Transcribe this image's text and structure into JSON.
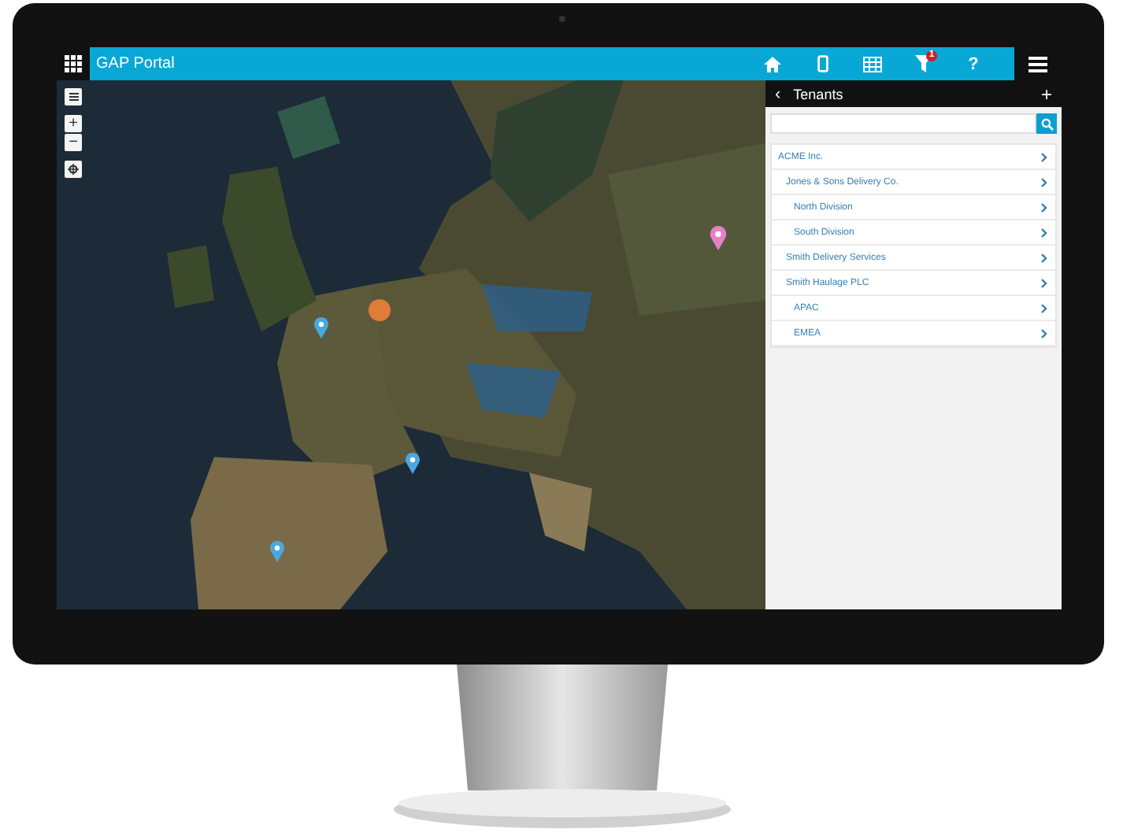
{
  "app_bar": {
    "title": "GAP Portal",
    "filter_badge": "1",
    "help": "?"
  },
  "map": {
    "zoom_in": "+",
    "zoom_out": "−"
  },
  "panel": {
    "title": "Tenants",
    "back": "‹",
    "add": "+",
    "tree": [
      {
        "label": "ACME Inc.",
        "children": [
          {
            "label": "Jones & Sons Delivery Co.",
            "children": [
              {
                "label": "North Division"
              },
              {
                "label": "South Division"
              }
            ]
          },
          {
            "label": "Smith Delivery Services"
          },
          {
            "label": "Smith Haulage PLC",
            "children": [
              {
                "label": "APAC"
              },
              {
                "label": "EMEA"
              }
            ]
          }
        ]
      }
    ]
  }
}
